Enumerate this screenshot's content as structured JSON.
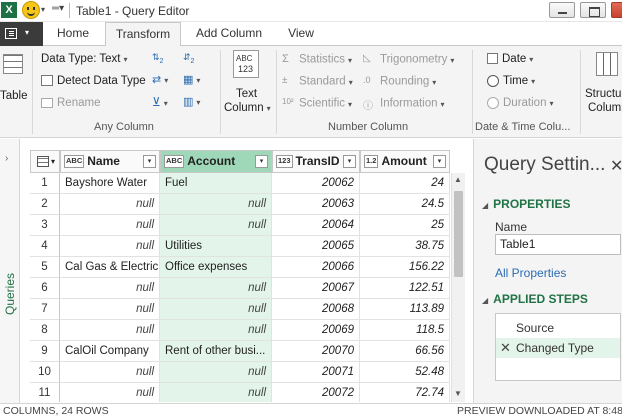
{
  "window": {
    "title": "Table1 - Query Editor"
  },
  "quick_access": {
    "app_glyph": "X",
    "undo_glyph": "▾"
  },
  "tabs": [
    {
      "label": "Home",
      "active": false
    },
    {
      "label": "Transform",
      "active": true
    },
    {
      "label": "Add Column",
      "active": false
    },
    {
      "label": "View",
      "active": false
    }
  ],
  "ribbon": {
    "table_label": "Table",
    "data_type": "Data Type: Text",
    "detect_data_type": "Detect Data Type",
    "rename": "Rename",
    "any_column": "Any Column",
    "text_column_label": "Text",
    "text_column_label2": "Column",
    "abc123_top": "ABC",
    "abc123_bottom": "123",
    "statistics": "Statistics",
    "standard": "Standard",
    "scientific": "Scientific",
    "trigonometry": "Trigonometry",
    "rounding": "Rounding",
    "information": "Information",
    "number_column": "Number Column",
    "date": "Date",
    "time": "Time",
    "duration": "Duration",
    "date_time_column": "Date & Time Colu...",
    "structured_column_1": "Structu",
    "structured_column_2": "Colum"
  },
  "queries_rail": {
    "label": "Queries"
  },
  "grid": {
    "columns": [
      {
        "name": "Name",
        "type": "ABC"
      },
      {
        "name": "Account",
        "type": "ABC"
      },
      {
        "name": "TransID",
        "type": "123"
      },
      {
        "name": "Amount",
        "type": "1.2"
      }
    ],
    "rows": [
      {
        "n": "1",
        "name": "Bayshore Water",
        "account": "Fuel",
        "transid": "20062",
        "amount": "24"
      },
      {
        "n": "2",
        "name": "null",
        "account": "null",
        "transid": "20063",
        "amount": "24.5"
      },
      {
        "n": "3",
        "name": "null",
        "account": "null",
        "transid": "20064",
        "amount": "25"
      },
      {
        "n": "4",
        "name": "null",
        "account": "Utilities",
        "transid": "20065",
        "amount": "38.75"
      },
      {
        "n": "5",
        "name": "Cal Gas & Electric",
        "account": "Office expenses",
        "transid": "20066",
        "amount": "156.22"
      },
      {
        "n": "6",
        "name": "null",
        "account": "null",
        "transid": "20067",
        "amount": "122.51"
      },
      {
        "n": "7",
        "name": "null",
        "account": "null",
        "transid": "20068",
        "amount": "113.89"
      },
      {
        "n": "8",
        "name": "null",
        "account": "null",
        "transid": "20069",
        "amount": "118.5"
      },
      {
        "n": "9",
        "name": "CalOil Company",
        "account": "Rent of other busi...",
        "transid": "20070",
        "amount": "66.56"
      },
      {
        "n": "10",
        "name": "null",
        "account": "null",
        "transid": "20071",
        "amount": "52.48"
      },
      {
        "n": "11",
        "name": "null",
        "account": "null",
        "transid": "20072",
        "amount": "72.74"
      }
    ]
  },
  "settings": {
    "title": "Query Settin...",
    "properties_header": "PROPERTIES",
    "name_label": "Name",
    "name_value": "Table1",
    "all_properties": "All Properties",
    "applied_steps_header": "APPLIED STEPS",
    "steps": [
      {
        "label": "Source",
        "selected": false
      },
      {
        "label": "Changed Type",
        "selected": true
      }
    ]
  },
  "status": {
    "left": "COLUMNS, 24 ROWS",
    "right": "PREVIEW DOWNLOADED AT 8:48"
  }
}
